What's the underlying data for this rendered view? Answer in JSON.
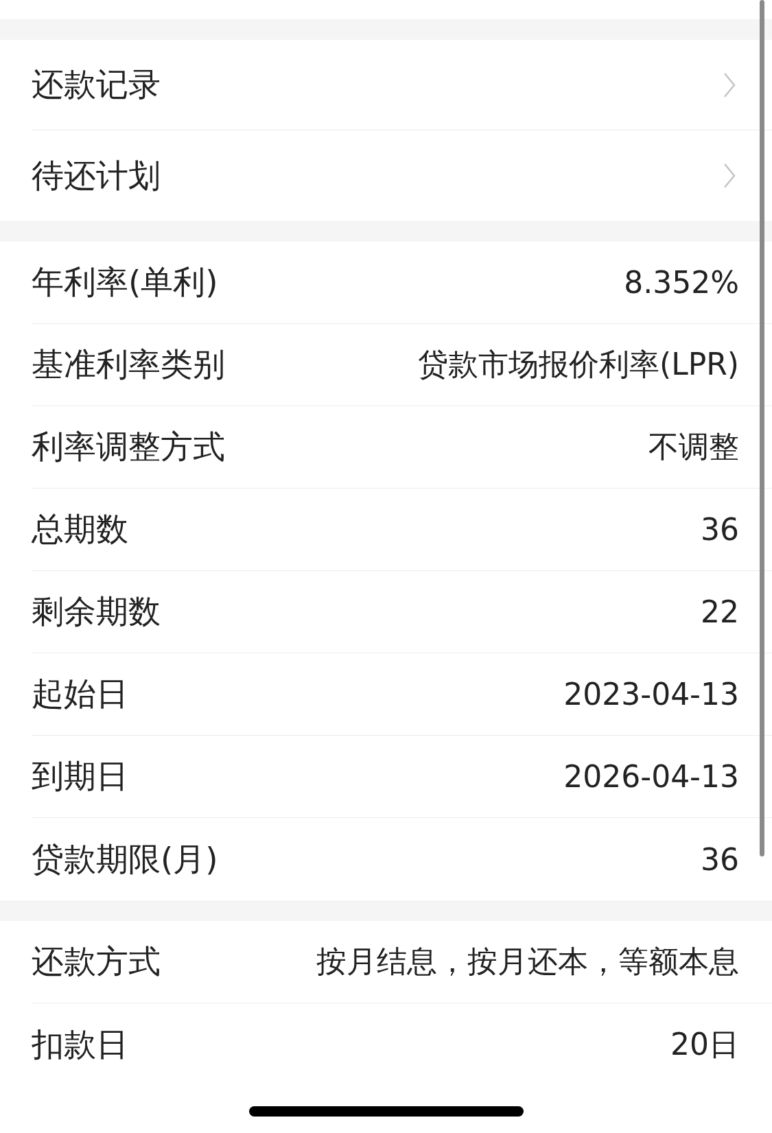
{
  "sections": [
    {
      "items": [
        {
          "kind": "link",
          "label": "还款记录"
        },
        {
          "kind": "link",
          "label": "待还计划"
        }
      ]
    },
    {
      "items": [
        {
          "kind": "value",
          "label": "年利率(单利)",
          "value": "8.352%"
        },
        {
          "kind": "value",
          "label": "基准利率类别",
          "value": "贷款市场报价利率(LPR)"
        },
        {
          "kind": "value",
          "label": "利率调整方式",
          "value": "不调整"
        },
        {
          "kind": "value",
          "label": "总期数",
          "value": "36"
        },
        {
          "kind": "value",
          "label": "剩余期数",
          "value": "22"
        },
        {
          "kind": "value",
          "label": "起始日",
          "value": "2023-04-13"
        },
        {
          "kind": "value",
          "label": "到期日",
          "value": "2026-04-13"
        },
        {
          "kind": "value",
          "label": "贷款期限(月)",
          "value": "36"
        }
      ]
    },
    {
      "items": [
        {
          "kind": "value",
          "label": "还款方式",
          "value": "按月结息，按月还本，等额本息"
        },
        {
          "kind": "value",
          "label": "扣款日",
          "value": "20日"
        }
      ]
    }
  ]
}
